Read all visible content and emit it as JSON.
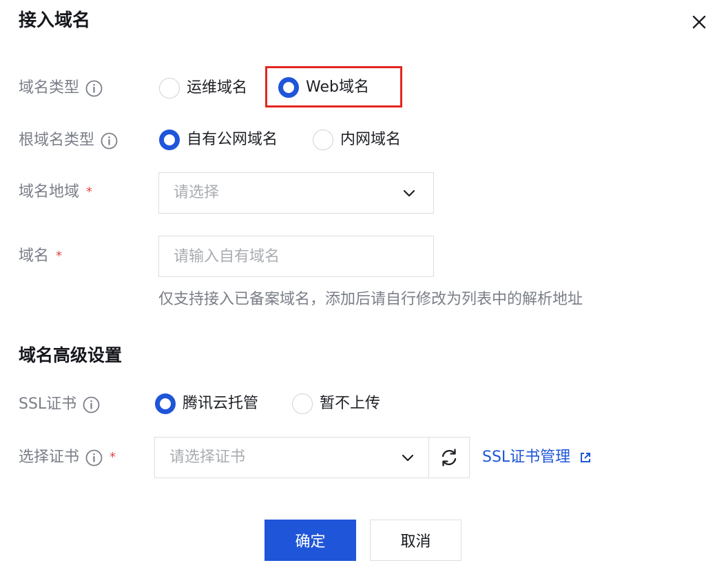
{
  "dialog": {
    "title": "接入域名",
    "close_icon": "close-icon"
  },
  "domain_type": {
    "label": "域名类型",
    "options": [
      {
        "label": "运维域名",
        "selected": false
      },
      {
        "label": "Web域名",
        "selected": true
      }
    ]
  },
  "root_domain_type": {
    "label": "根域名类型",
    "options": [
      {
        "label": "自有公网域名",
        "selected": true
      },
      {
        "label": "内网域名",
        "selected": false
      }
    ]
  },
  "domain_region": {
    "label": "域名地域",
    "required_mark": "*",
    "placeholder": "请选择"
  },
  "domain": {
    "label": "域名",
    "required_mark": "*",
    "placeholder": "请输入自有域名",
    "hint": "仅支持接入已备案域名，添加后请自行修改为列表中的解析地址"
  },
  "advanced": {
    "title": "域名高级设置",
    "ssl": {
      "label": "SSL证书",
      "options": [
        {
          "label": "腾讯云托管",
          "selected": true
        },
        {
          "label": "暂不上传",
          "selected": false
        }
      ]
    },
    "cert": {
      "label": "选择证书",
      "required_mark": "*",
      "placeholder": "请选择证书",
      "manage_link": "SSL证书管理"
    }
  },
  "footer": {
    "confirm": "确定",
    "cancel": "取消"
  },
  "colors": {
    "primary": "#1f55d8",
    "highlight_border": "#e3261f",
    "required": "#e54545"
  }
}
